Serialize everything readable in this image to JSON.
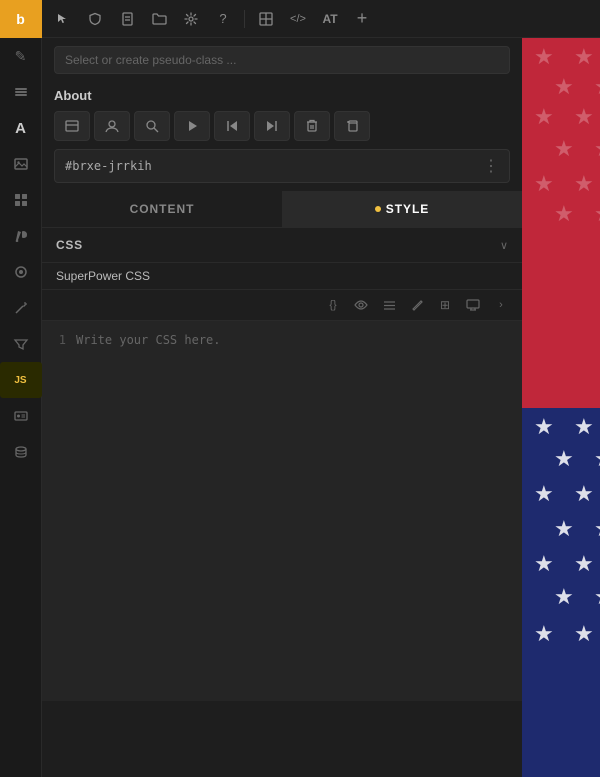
{
  "toolbar": {
    "logo": "b",
    "icons": [
      "◇",
      "⬡",
      "⬛",
      "📁",
      "⚙",
      "?",
      "⊞",
      "</>",
      "AT",
      "+"
    ]
  },
  "sidebar": {
    "icons": [
      {
        "name": "pen-icon",
        "glyph": "✎",
        "active": false
      },
      {
        "name": "layers-icon",
        "glyph": "⊟",
        "active": false
      },
      {
        "name": "text-icon",
        "glyph": "A",
        "active": false
      },
      {
        "name": "image-icon",
        "glyph": "⬚",
        "active": false
      },
      {
        "name": "grid-icon",
        "glyph": "⊞",
        "active": false
      },
      {
        "name": "paint-icon",
        "glyph": "🖌",
        "active": false
      },
      {
        "name": "shape-icon",
        "glyph": "◉",
        "active": false
      },
      {
        "name": "wand-icon",
        "glyph": "✦",
        "active": false
      },
      {
        "name": "filter-icon",
        "glyph": "⫠",
        "active": false
      },
      {
        "name": "js-icon",
        "glyph": "JS",
        "active": true
      },
      {
        "name": "id-card-icon",
        "glyph": "🪪",
        "active": false
      },
      {
        "name": "db-icon",
        "glyph": "🗃",
        "active": false
      }
    ]
  },
  "pseudo_class": {
    "placeholder": "Select or create pseudo-class ..."
  },
  "about": {
    "title": "About",
    "icons": [
      "☰",
      "👤",
      "🔍",
      "▷",
      "|◁",
      "▷|",
      "🗑",
      "⊟"
    ]
  },
  "element_id": {
    "value": "#brxe-jrrkih",
    "dots": "⋮"
  },
  "tabs": {
    "content_label": "CONTENT",
    "style_label": "STYLE",
    "style_has_dot": true
  },
  "css_section": {
    "label": "CSS",
    "superpower_label": "SuperPower CSS",
    "placeholder": "Write your CSS here.",
    "line_number": "1"
  }
}
